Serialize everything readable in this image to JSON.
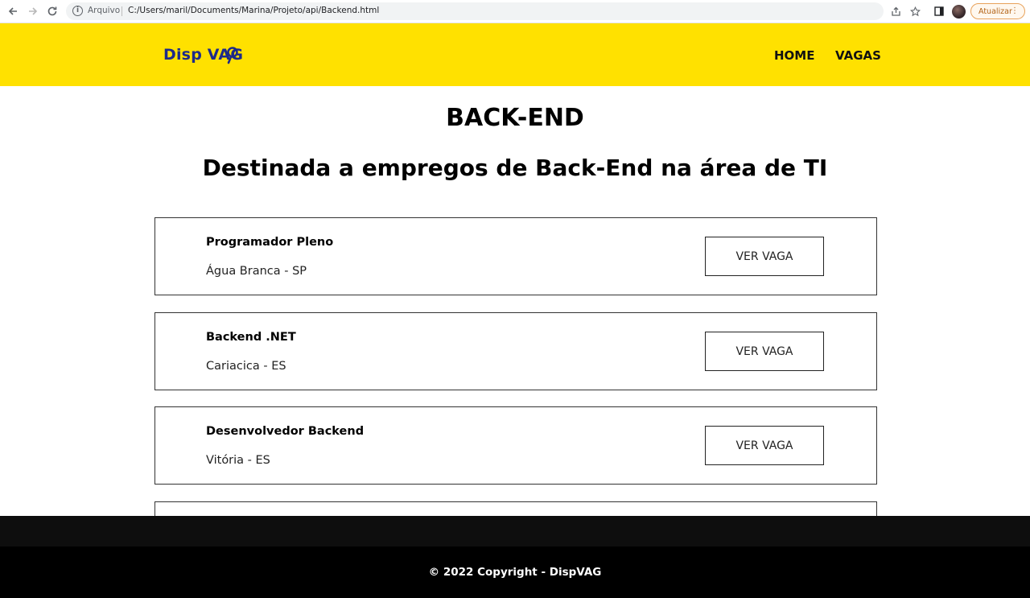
{
  "browser": {
    "back_icon": "arrow-left-icon",
    "forward_icon": "arrow-right-icon",
    "reload_icon": "reload-icon",
    "scheme_label": "Arquivo",
    "url": "C:/Users/maril/Documents/Marina/Projeto/api/Backend.html",
    "update_label": "Atualizar"
  },
  "header": {
    "logo_text": "Disp VAG",
    "nav": [
      {
        "label": "HOME"
      },
      {
        "label": "VAGAS"
      }
    ],
    "background_color": "#ffe100",
    "logo_color": "#1d2a8a"
  },
  "main": {
    "title": "BACK-END",
    "subtitle": "Destinada a empregos de Back-End na área de TI",
    "jobs": [
      {
        "title": "Programador Pleno",
        "location": "Água Branca - SP",
        "button": "VER VAGA"
      },
      {
        "title": "Backend .NET",
        "location": "Cariacica - ES",
        "button": "VER VAGA"
      },
      {
        "title": "Desenvolvedor Backend",
        "location": "Vitória - ES",
        "button": "VER VAGA"
      }
    ]
  },
  "footer": {
    "copyright": "© 2022 Copyright - DispVAG"
  }
}
